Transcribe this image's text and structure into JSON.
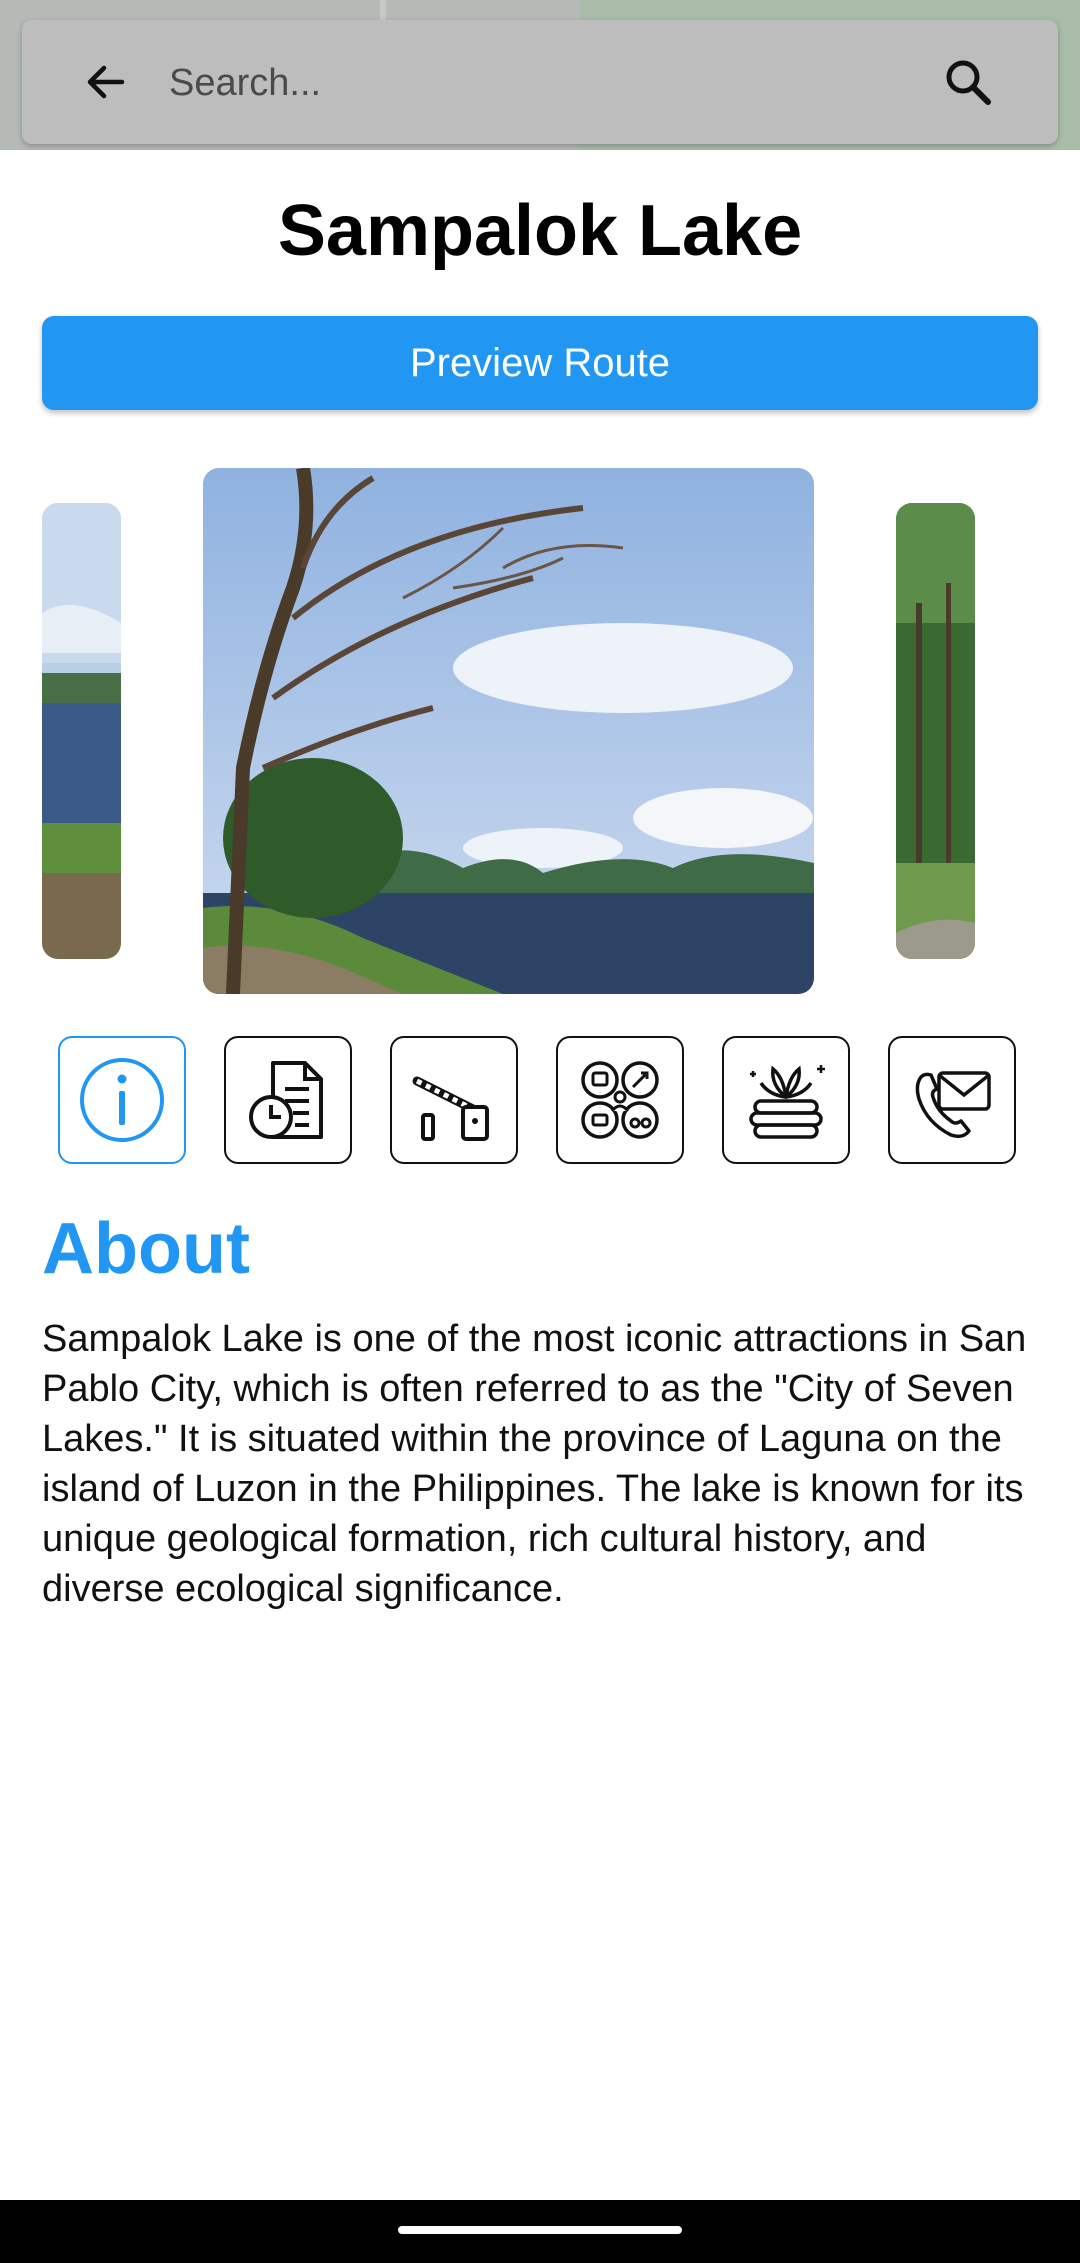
{
  "search": {
    "placeholder": "Search..."
  },
  "place": {
    "title": "Sampalok Lake"
  },
  "actions": {
    "preview_route_label": "Preview Route"
  },
  "tabs": [
    {
      "icon": "info-icon",
      "active": true
    },
    {
      "icon": "document-clock-icon",
      "active": false
    },
    {
      "icon": "gate-barrier-icon",
      "active": false
    },
    {
      "icon": "activities-icon",
      "active": false
    },
    {
      "icon": "spa-stones-icon",
      "active": false
    },
    {
      "icon": "phone-mail-icon",
      "active": false
    }
  ],
  "about": {
    "heading": "About",
    "body": "Sampalok Lake is one of the most iconic attractions in San Pablo City, which is often referred to as the \"City of Seven Lakes.\" It is situated within the province of Laguna on the island of Luzon in the Philippines. The lake is known for its unique geological formation, rich cultural history, and diverse ecological significance."
  },
  "colors": {
    "accent": "#2196f3",
    "searchbar": "#bdbdbd"
  }
}
